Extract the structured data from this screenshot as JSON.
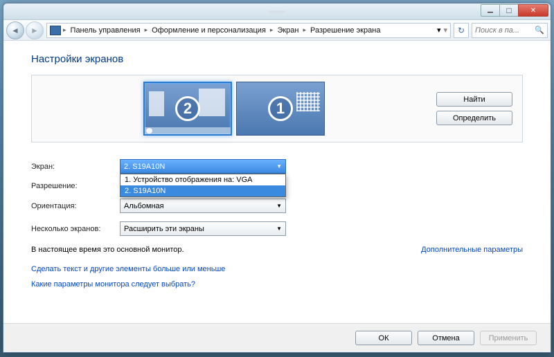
{
  "breadcrumb": {
    "items": [
      "Панель управления",
      "Оформление и персонализация",
      "Экран",
      "Разрешение экрана"
    ]
  },
  "search": {
    "placeholder": "Поиск в па..."
  },
  "heading": "Настройки экранов",
  "sidebuttons": {
    "find": "Найти",
    "identify": "Определить"
  },
  "monitors": {
    "active": 2,
    "other": 1
  },
  "labels": {
    "display": "Экран:",
    "resolution": "Разрешение:",
    "orientation": "Ориентация:",
    "multi": "Несколько экранов:"
  },
  "display_combo": {
    "selected": "2. S19A10N",
    "options": [
      "1. Устройство отображения на: VGA",
      "2. S19A10N"
    ],
    "selected_index": 1
  },
  "orientation_combo": {
    "selected": "Альбомная"
  },
  "multi_combo": {
    "selected": "Расширить эти экраны"
  },
  "status_text": "В настоящее время это основной монитор.",
  "link_advanced": "Дополнительные параметры",
  "link_textsize": "Сделать текст и другие элементы больше или меньше",
  "link_help": "Какие параметры монитора следует выбрать?",
  "buttons": {
    "ok": "ОК",
    "cancel": "Отмена",
    "apply": "Применить"
  }
}
